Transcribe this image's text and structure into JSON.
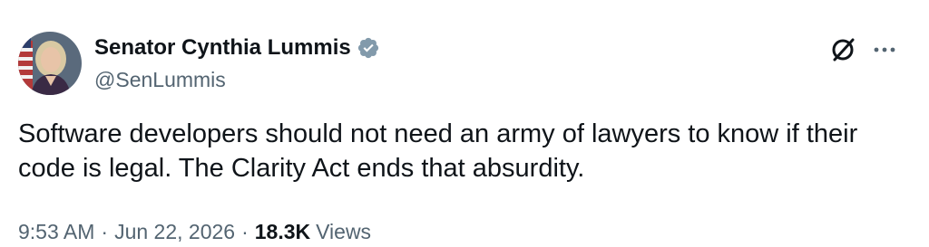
{
  "author": {
    "display_name": "Senator Cynthia Lummis",
    "handle": "@SenLummis",
    "verified_icon": "verified-badge-icon",
    "badge_color": "#829aab"
  },
  "header_actions": {
    "grok_icon": "grok-icon",
    "more_icon": "more-options-icon"
  },
  "tweet": {
    "text": "Software developers should not need an army of lawyers to know if their\ncode is legal. The Clarity Act ends that absurdity."
  },
  "meta": {
    "time": "9:53 AM",
    "separator": "·",
    "date": "Jun 22, 2026",
    "views_count": "18.3K",
    "views_label": "Views"
  },
  "colors": {
    "text_primary": "#0f1419",
    "text_secondary": "#536471",
    "background": "#ffffff"
  }
}
